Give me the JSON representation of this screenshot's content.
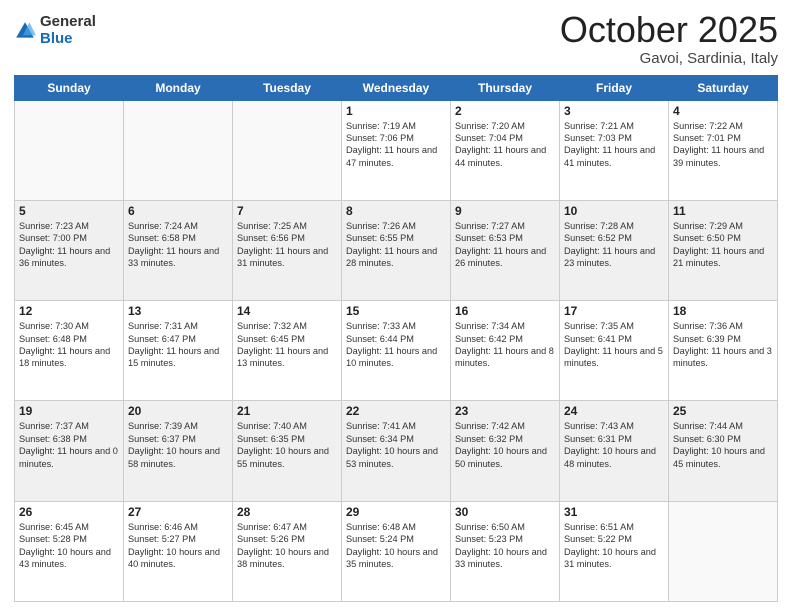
{
  "header": {
    "logo_general": "General",
    "logo_blue": "Blue",
    "month": "October 2025",
    "location": "Gavoi, Sardinia, Italy"
  },
  "weekdays": [
    "Sunday",
    "Monday",
    "Tuesday",
    "Wednesday",
    "Thursday",
    "Friday",
    "Saturday"
  ],
  "rows": [
    [
      {
        "day": "",
        "text": ""
      },
      {
        "day": "",
        "text": ""
      },
      {
        "day": "",
        "text": ""
      },
      {
        "day": "1",
        "text": "Sunrise: 7:19 AM\nSunset: 7:06 PM\nDaylight: 11 hours and 47 minutes."
      },
      {
        "day": "2",
        "text": "Sunrise: 7:20 AM\nSunset: 7:04 PM\nDaylight: 11 hours and 44 minutes."
      },
      {
        "day": "3",
        "text": "Sunrise: 7:21 AM\nSunset: 7:03 PM\nDaylight: 11 hours and 41 minutes."
      },
      {
        "day": "4",
        "text": "Sunrise: 7:22 AM\nSunset: 7:01 PM\nDaylight: 11 hours and 39 minutes."
      }
    ],
    [
      {
        "day": "5",
        "text": "Sunrise: 7:23 AM\nSunset: 7:00 PM\nDaylight: 11 hours and 36 minutes."
      },
      {
        "day": "6",
        "text": "Sunrise: 7:24 AM\nSunset: 6:58 PM\nDaylight: 11 hours and 33 minutes."
      },
      {
        "day": "7",
        "text": "Sunrise: 7:25 AM\nSunset: 6:56 PM\nDaylight: 11 hours and 31 minutes."
      },
      {
        "day": "8",
        "text": "Sunrise: 7:26 AM\nSunset: 6:55 PM\nDaylight: 11 hours and 28 minutes."
      },
      {
        "day": "9",
        "text": "Sunrise: 7:27 AM\nSunset: 6:53 PM\nDaylight: 11 hours and 26 minutes."
      },
      {
        "day": "10",
        "text": "Sunrise: 7:28 AM\nSunset: 6:52 PM\nDaylight: 11 hours and 23 minutes."
      },
      {
        "day": "11",
        "text": "Sunrise: 7:29 AM\nSunset: 6:50 PM\nDaylight: 11 hours and 21 minutes."
      }
    ],
    [
      {
        "day": "12",
        "text": "Sunrise: 7:30 AM\nSunset: 6:48 PM\nDaylight: 11 hours and 18 minutes."
      },
      {
        "day": "13",
        "text": "Sunrise: 7:31 AM\nSunset: 6:47 PM\nDaylight: 11 hours and 15 minutes."
      },
      {
        "day": "14",
        "text": "Sunrise: 7:32 AM\nSunset: 6:45 PM\nDaylight: 11 hours and 13 minutes."
      },
      {
        "day": "15",
        "text": "Sunrise: 7:33 AM\nSunset: 6:44 PM\nDaylight: 11 hours and 10 minutes."
      },
      {
        "day": "16",
        "text": "Sunrise: 7:34 AM\nSunset: 6:42 PM\nDaylight: 11 hours and 8 minutes."
      },
      {
        "day": "17",
        "text": "Sunrise: 7:35 AM\nSunset: 6:41 PM\nDaylight: 11 hours and 5 minutes."
      },
      {
        "day": "18",
        "text": "Sunrise: 7:36 AM\nSunset: 6:39 PM\nDaylight: 11 hours and 3 minutes."
      }
    ],
    [
      {
        "day": "19",
        "text": "Sunrise: 7:37 AM\nSunset: 6:38 PM\nDaylight: 11 hours and 0 minutes."
      },
      {
        "day": "20",
        "text": "Sunrise: 7:39 AM\nSunset: 6:37 PM\nDaylight: 10 hours and 58 minutes."
      },
      {
        "day": "21",
        "text": "Sunrise: 7:40 AM\nSunset: 6:35 PM\nDaylight: 10 hours and 55 minutes."
      },
      {
        "day": "22",
        "text": "Sunrise: 7:41 AM\nSunset: 6:34 PM\nDaylight: 10 hours and 53 minutes."
      },
      {
        "day": "23",
        "text": "Sunrise: 7:42 AM\nSunset: 6:32 PM\nDaylight: 10 hours and 50 minutes."
      },
      {
        "day": "24",
        "text": "Sunrise: 7:43 AM\nSunset: 6:31 PM\nDaylight: 10 hours and 48 minutes."
      },
      {
        "day": "25",
        "text": "Sunrise: 7:44 AM\nSunset: 6:30 PM\nDaylight: 10 hours and 45 minutes."
      }
    ],
    [
      {
        "day": "26",
        "text": "Sunrise: 6:45 AM\nSunset: 5:28 PM\nDaylight: 10 hours and 43 minutes."
      },
      {
        "day": "27",
        "text": "Sunrise: 6:46 AM\nSunset: 5:27 PM\nDaylight: 10 hours and 40 minutes."
      },
      {
        "day": "28",
        "text": "Sunrise: 6:47 AM\nSunset: 5:26 PM\nDaylight: 10 hours and 38 minutes."
      },
      {
        "day": "29",
        "text": "Sunrise: 6:48 AM\nSunset: 5:24 PM\nDaylight: 10 hours and 35 minutes."
      },
      {
        "day": "30",
        "text": "Sunrise: 6:50 AM\nSunset: 5:23 PM\nDaylight: 10 hours and 33 minutes."
      },
      {
        "day": "31",
        "text": "Sunrise: 6:51 AM\nSunset: 5:22 PM\nDaylight: 10 hours and 31 minutes."
      },
      {
        "day": "",
        "text": ""
      }
    ]
  ],
  "row_styles": [
    "white",
    "shaded",
    "white",
    "shaded",
    "white"
  ]
}
